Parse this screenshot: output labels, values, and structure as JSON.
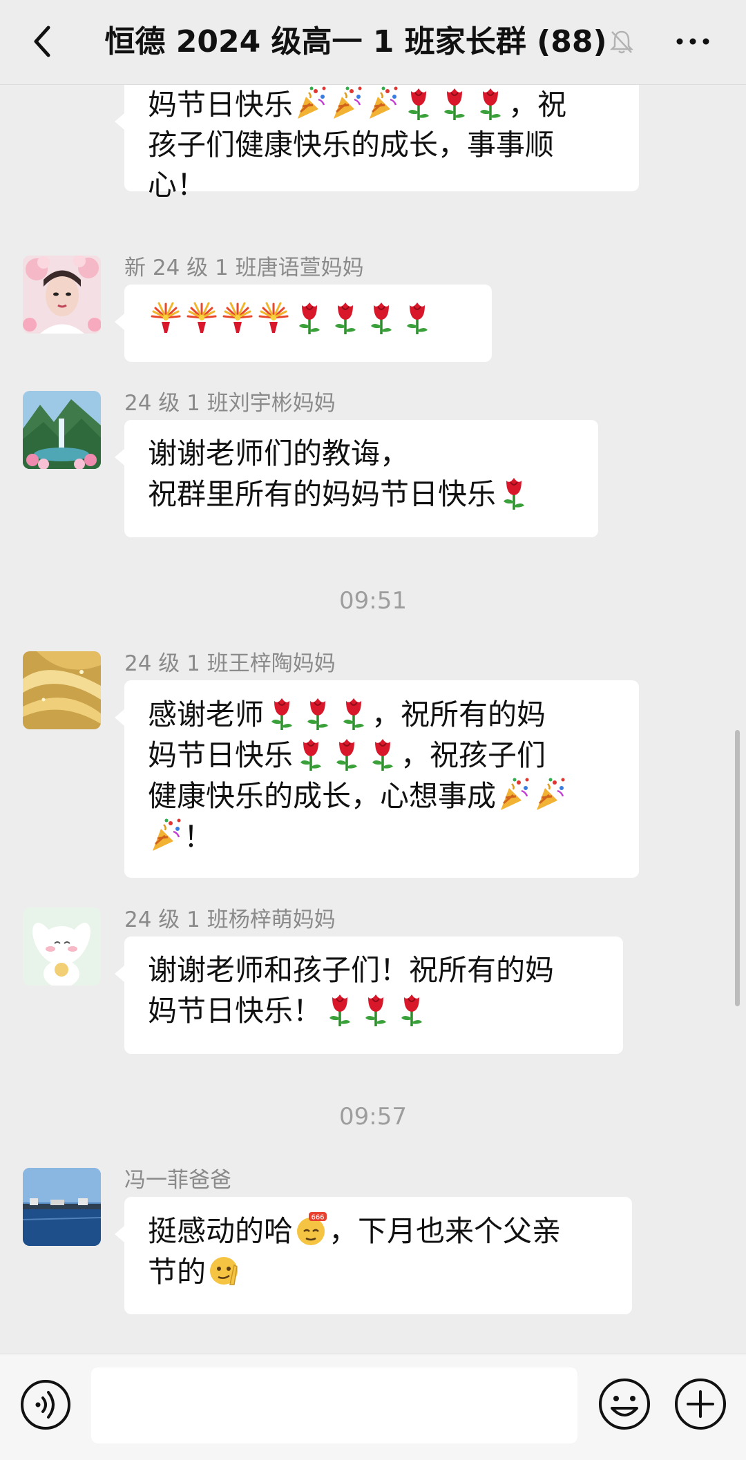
{
  "header": {
    "title": "恒德 2024 级高一 1 班家长群 (88)",
    "icons": {
      "back": "chevron-left-icon",
      "mute": "bell-muted-icon",
      "more": "more-horizontal-icon"
    }
  },
  "messages": [
    {
      "sender": "",
      "lines": [
        "妈节日快乐🎉🎉🎉🌹🌹🌹，祝",
        "孩子们健康快乐的成长，事事顺",
        "心！"
      ]
    },
    {
      "sender": "新 24 级 1 班唐语萱妈妈",
      "lines": [
        "🎆🎆🎆🎆🌹🌹🌹🌹"
      ]
    },
    {
      "sender": "24 级 1 班刘宇彬妈妈",
      "lines": [
        "谢谢老师们的教诲，",
        "祝群里所有的妈妈节日快乐🌹"
      ]
    },
    {
      "sender": "24 级 1 班王梓陶妈妈",
      "lines": [
        "感谢老师🌹🌹🌹，祝所有的妈",
        "妈节日快乐🌹🌹🌹，祝孩子们",
        "健康快乐的成长，心想事成🎉🎉",
        "🎉！"
      ]
    },
    {
      "sender": "24 级 1 班杨梓萌妈妈",
      "lines": [
        "谢谢老师和孩子们！祝所有的妈",
        "妈节日快乐！🌹🌹🌹"
      ]
    },
    {
      "sender": "冯一菲爸爸",
      "lines": [
        "挺感动的哈[666]，下月也来个父亲",
        "节的[机智]"
      ]
    }
  ],
  "timestamps": [
    "09:51",
    "09:57"
  ],
  "input": {
    "value": "",
    "placeholder": ""
  },
  "bottom_icons": {
    "voice": "voice-icon",
    "emoji": "emoji-icon",
    "plus": "plus-icon"
  },
  "colors": {
    "background": "#ededed",
    "bubble": "#ffffff",
    "sender": "#8a8a8a",
    "timestamp": "#9d9d9d"
  }
}
